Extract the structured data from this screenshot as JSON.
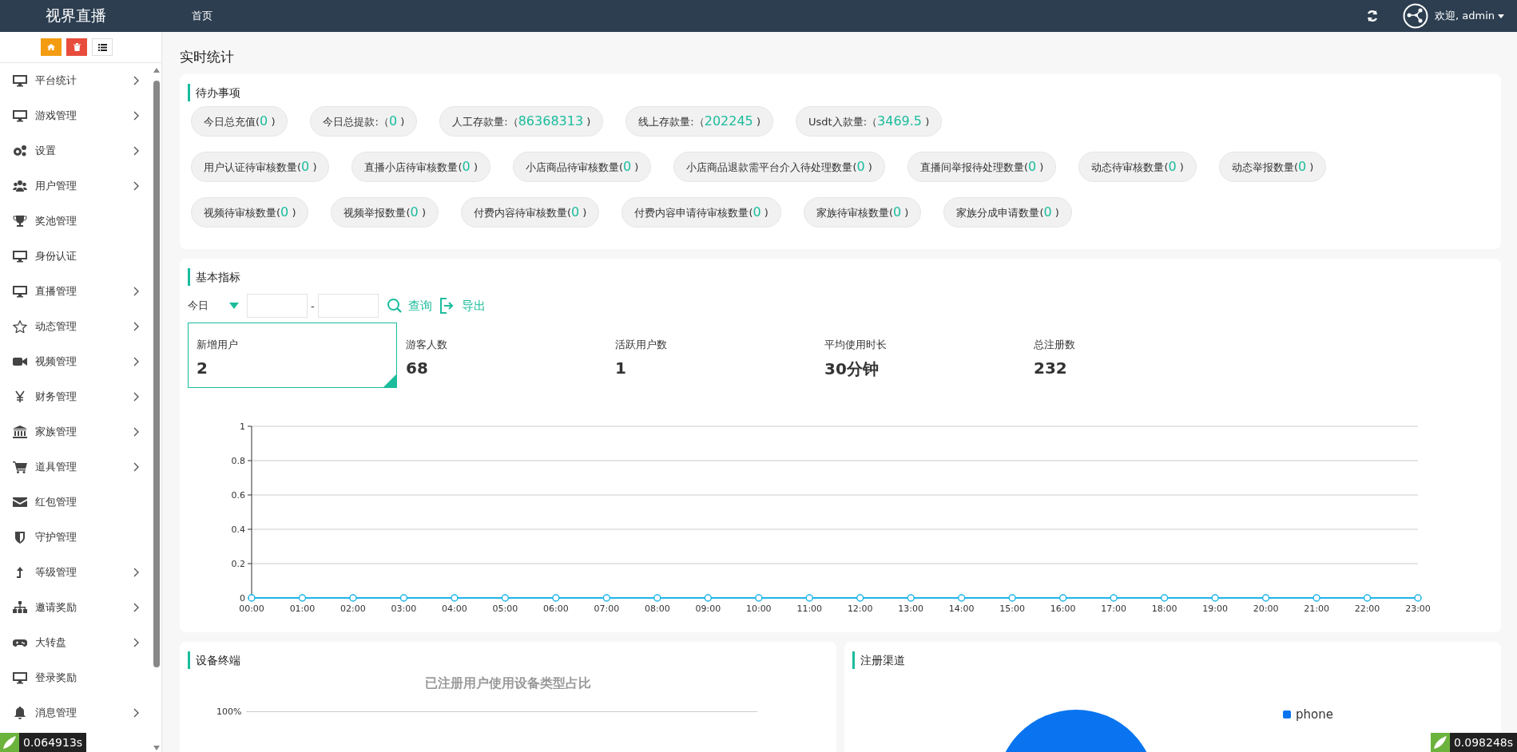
{
  "topbar": {
    "logo": "视界直播",
    "nav": [
      "首页"
    ],
    "user": "欢迎, admin"
  },
  "sidebar": {
    "items": [
      {
        "label": "平台统计",
        "has_children": true
      },
      {
        "label": "游戏管理",
        "has_children": true
      },
      {
        "label": "设置",
        "has_children": true
      },
      {
        "label": "用户管理",
        "has_children": true
      },
      {
        "label": "奖池管理",
        "has_children": false
      },
      {
        "label": "身份认证",
        "has_children": false
      },
      {
        "label": "直播管理",
        "has_children": true
      },
      {
        "label": "动态管理",
        "has_children": true
      },
      {
        "label": "视频管理",
        "has_children": true
      },
      {
        "label": "财务管理",
        "has_children": true
      },
      {
        "label": "家族管理",
        "has_children": true
      },
      {
        "label": "道具管理",
        "has_children": true
      },
      {
        "label": "红包管理",
        "has_children": false
      },
      {
        "label": "守护管理",
        "has_children": false
      },
      {
        "label": "等级管理",
        "has_children": true
      },
      {
        "label": "邀请奖励",
        "has_children": true
      },
      {
        "label": "大转盘",
        "has_children": true
      },
      {
        "label": "登录奖励",
        "has_children": false
      },
      {
        "label": "消息管理",
        "has_children": true
      }
    ]
  },
  "page_title": "实时统计",
  "todo": {
    "title": "待办事项",
    "groups": [
      {
        "items": [
          {
            "label": "今日总充值(",
            "value": "0",
            "close": ")"
          },
          {
            "label": "今日总提款:（",
            "value": "0",
            "close": ")"
          },
          {
            "label": "人工存款量:（",
            "value": "86368313",
            "close": ")"
          },
          {
            "label": "线上存款量:（",
            "value": "202245",
            "close": ")"
          },
          {
            "label": "Usdt入款量:（",
            "value": "3469.5",
            "close": ")"
          }
        ]
      },
      {
        "items": [
          {
            "label": "用户认证待审核数量(",
            "value": "0",
            "close": ")"
          },
          {
            "label": "直播小店待审核数量(",
            "value": "0",
            "close": ")"
          },
          {
            "label": "小店商品待审核数量(",
            "value": "0",
            "close": ")"
          },
          {
            "label": "小店商品退款需平台介入待处理数量(",
            "value": "0",
            "close": ")"
          },
          {
            "label": "直播间举报待处理数量(",
            "value": "0",
            "close": ")"
          },
          {
            "label": "动态待审核数量(",
            "value": "0",
            "close": ")"
          },
          {
            "label": "动态举报数量(",
            "value": "0",
            "close": ")"
          }
        ]
      },
      {
        "items": [
          {
            "label": "视频待审核数量(",
            "value": "0",
            "close": ")"
          },
          {
            "label": "视频举报数量(",
            "value": "0",
            "close": ")"
          },
          {
            "label": "付费内容待审核数量(",
            "value": "0",
            "close": ")"
          },
          {
            "label": "付费内容申请待审核数量(",
            "value": "0",
            "close": ")"
          },
          {
            "label": "家族待审核数量(",
            "value": "0",
            "close": ")"
          },
          {
            "label": "家族分成申请数量(",
            "value": "0",
            "close": ")"
          }
        ]
      }
    ]
  },
  "metrics": {
    "title": "基本指标",
    "period": "今日",
    "separator": "-",
    "query": "查询",
    "export": "导出",
    "cards": [
      {
        "label": "新增用户",
        "value": "2",
        "selected": true
      },
      {
        "label": "游客人数",
        "value": "68",
        "selected": false
      },
      {
        "label": "活跃用户数",
        "value": "1",
        "selected": false
      },
      {
        "label": "平均使用时长",
        "value": "30分钟",
        "selected": false
      },
      {
        "label": "总注册数",
        "value": "232",
        "selected": false
      }
    ],
    "chart_data": {
      "type": "line",
      "grid": true,
      "categories": [
        "00:00",
        "01:00",
        "02:00",
        "03:00",
        "04:00",
        "05:00",
        "06:00",
        "07:00",
        "08:00",
        "09:00",
        "10:00",
        "11:00",
        "12:00",
        "13:00",
        "14:00",
        "15:00",
        "16:00",
        "17:00",
        "18:00",
        "19:00",
        "20:00",
        "21:00",
        "22:00",
        "23:00"
      ],
      "ylim": [
        0,
        1
      ],
      "yticks": [
        0,
        0.2,
        0.4,
        0.6,
        0.8,
        1
      ],
      "series": [
        {
          "color": "#1fb5e8",
          "marker": "circle",
          "values": [
            0,
            0,
            0,
            0,
            0,
            0,
            0,
            0,
            0,
            0,
            0,
            0,
            0,
            0,
            0,
            0,
            0,
            0,
            0,
            0,
            0,
            0,
            0,
            0
          ]
        }
      ]
    }
  },
  "devices": {
    "title": "设备终端",
    "chart_title": "已注册用户使用设备类型占比",
    "axis_tick": "100%"
  },
  "channels": {
    "title": "注册渠道",
    "legend": [
      {
        "name": "phone",
        "color": "#0a74f0"
      }
    ]
  },
  "timers": [
    "0.064913s",
    "0.098248s"
  ]
}
